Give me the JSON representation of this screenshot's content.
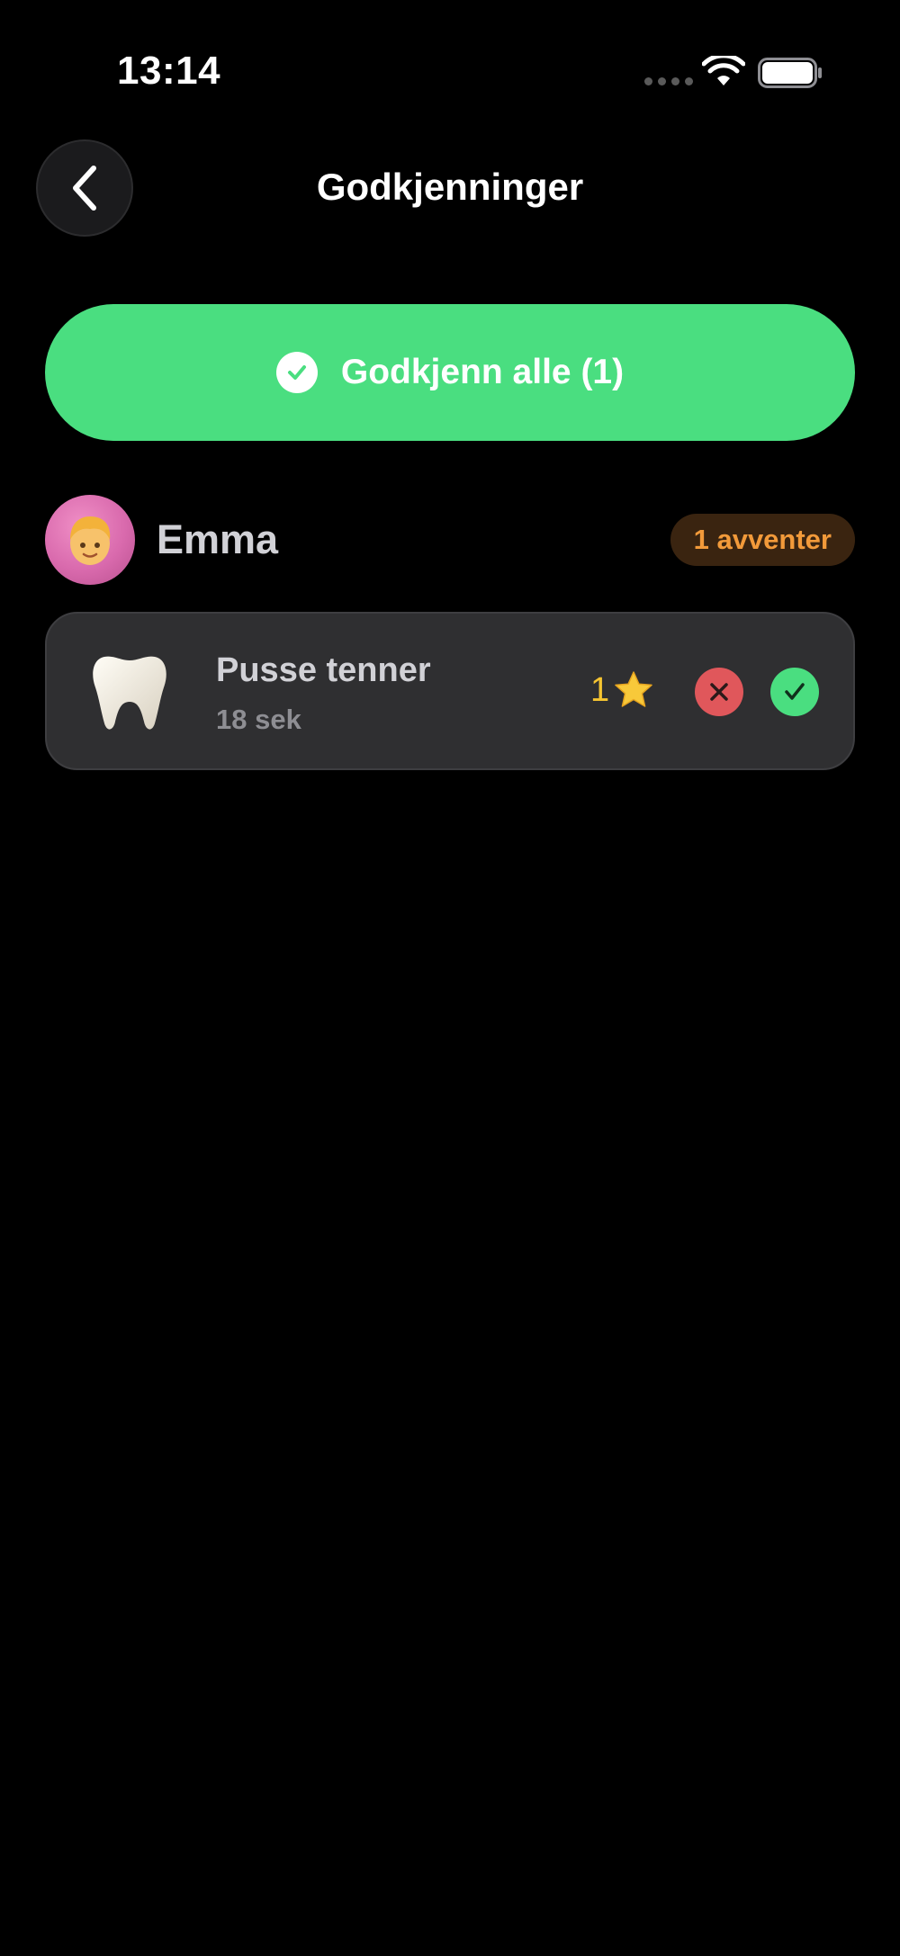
{
  "status_bar": {
    "time": "13:14",
    "icons": [
      "signal-icon",
      "wifi-icon",
      "battery-icon"
    ]
  },
  "header": {
    "title": "Godkjenninger",
    "back_icon": "chevron-left-icon"
  },
  "approve_all": {
    "label": "Godkjenn alle (1)",
    "icon": "checkmark-circle-icon"
  },
  "child": {
    "name": "Emma",
    "avatar_icon": "child-face-emoji",
    "pending_badge": "1 avventer"
  },
  "tasks": [
    {
      "title": "Pusse tenner",
      "duration": "18 sek",
      "icon": "tooth-icon",
      "stars": "1",
      "star_icon": "star-icon",
      "reject_icon": "x-icon",
      "approve_icon": "checkmark-icon"
    }
  ],
  "colors": {
    "background": "#000000",
    "accent_green": "#4ade80",
    "reject_red": "#e0575b",
    "pending_orange": "#f29a3a",
    "star_yellow": "#f5c431",
    "card": "#2f2f31"
  }
}
